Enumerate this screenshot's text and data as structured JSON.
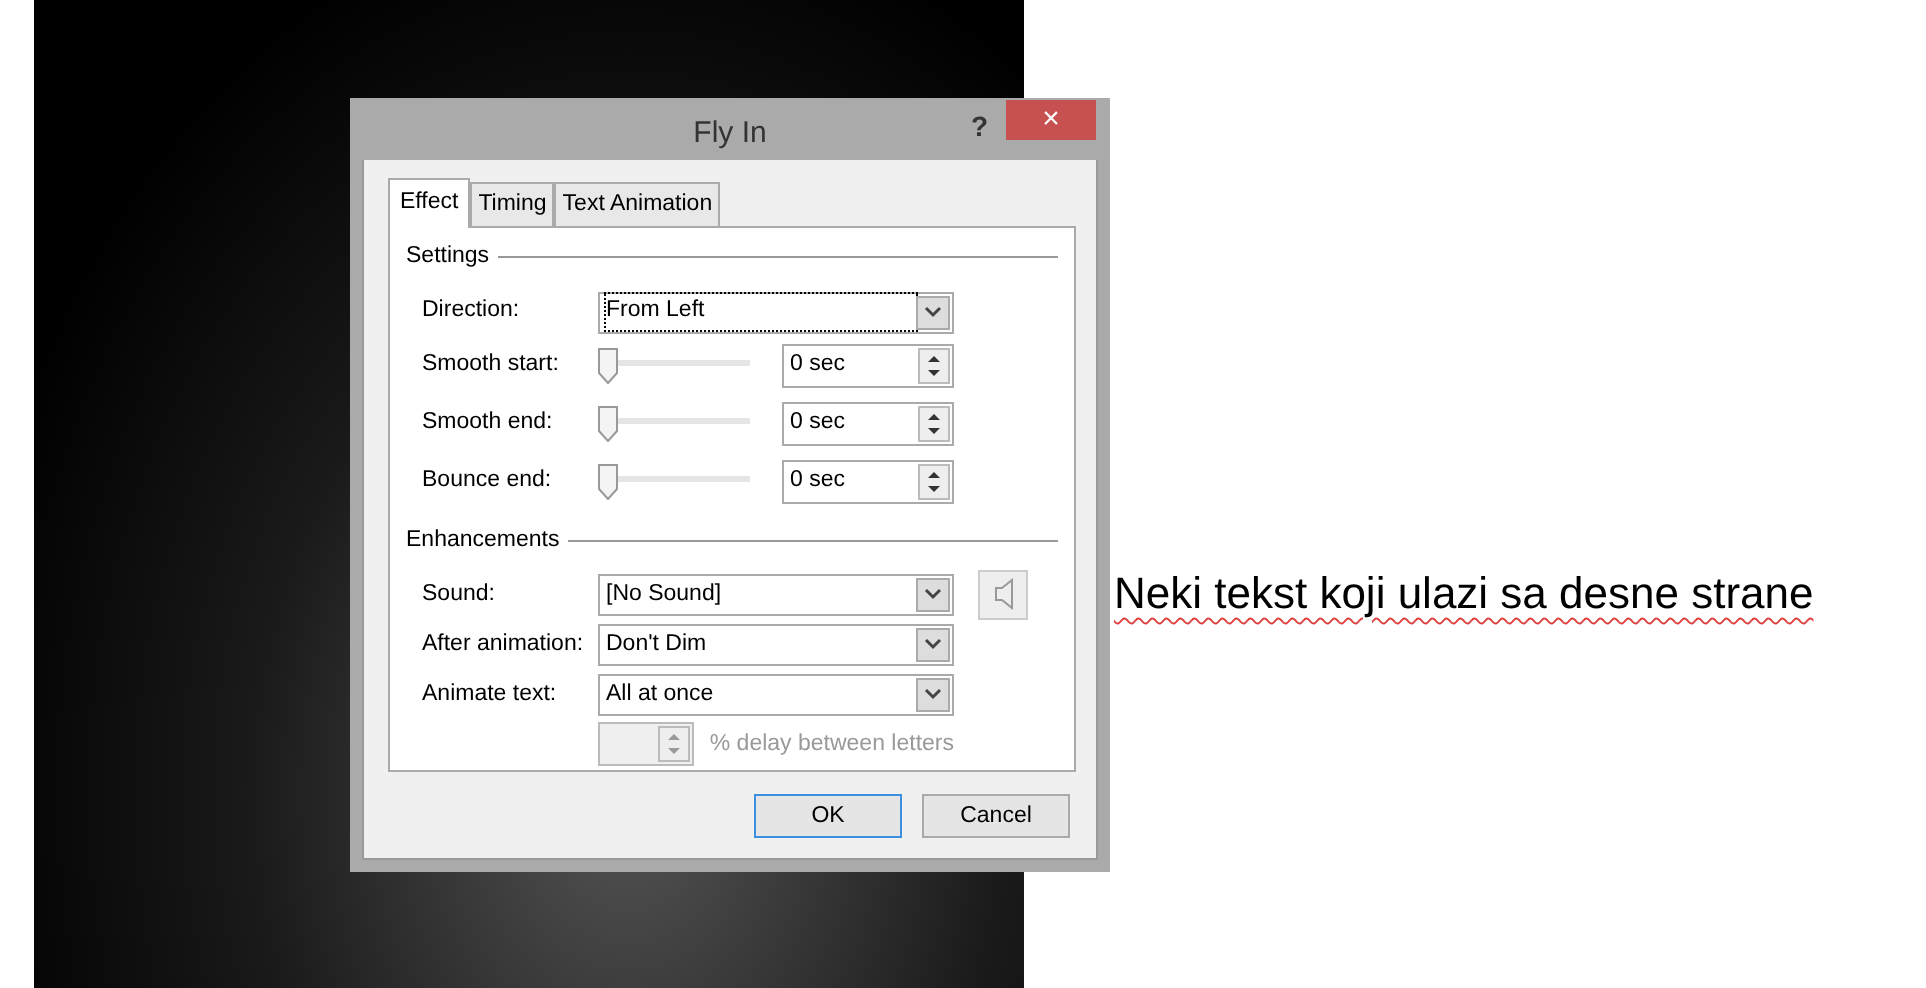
{
  "slide_text": "Neki tekst koji ulazi sa desne strane",
  "dialog": {
    "title": "Fly In",
    "help": "?",
    "close": "×",
    "tabs": [
      {
        "label": "Effect",
        "selected": true
      },
      {
        "label": "Timing",
        "selected": false
      },
      {
        "label": "Text Animation",
        "selected": false
      }
    ],
    "settings": {
      "title": "Settings",
      "rows": [
        {
          "kind": "dropdown",
          "label": "Direction:",
          "value": "From Left",
          "focused": true
        },
        {
          "kind": "slider",
          "label": "Smooth start:",
          "level": 0,
          "value": "0 sec"
        },
        {
          "kind": "slider",
          "label": "Smooth end:",
          "level": 0,
          "value": "0 sec"
        },
        {
          "kind": "slider",
          "label": "Bounce end:",
          "level": 0,
          "value": "0 sec"
        }
      ]
    },
    "enhancements": {
      "title": "Enhancements",
      "rows": [
        {
          "kind": "dropdown",
          "label": "Sound:",
          "value": "[No Sound]",
          "sound_button": true
        },
        {
          "kind": "dropdown",
          "label": "After animation:",
          "value": "Don't Dim"
        },
        {
          "kind": "dropdown",
          "label": "Animate text:",
          "value": "All at once"
        }
      ],
      "delay": {
        "disabled": true,
        "label": "% delay between letters"
      }
    },
    "buttons": [
      {
        "label": "OK",
        "default": true
      },
      {
        "label": "Cancel",
        "default": false
      }
    ]
  }
}
